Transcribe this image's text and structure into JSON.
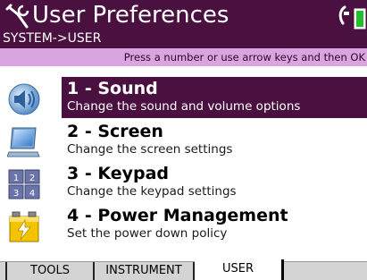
{
  "header": {
    "title": "User Preferences",
    "path": "SYSTEM->USER"
  },
  "hint": "Press a number or use arrow keys and then OK",
  "menu": {
    "items": [
      {
        "title": "1 - Sound",
        "description": "Change the sound and volume options",
        "icon": "speaker-icon",
        "selected": true
      },
      {
        "title": "2 - Screen",
        "description": "Change the screen settings",
        "icon": "monitor-icon",
        "selected": false
      },
      {
        "title": "3 - Keypad",
        "description": "Change the keypad settings",
        "icon": "keypad-icon",
        "selected": false
      },
      {
        "title": "4 - Power Management",
        "description": "Set the power down policy",
        "icon": "battery-charge-icon",
        "selected": false
      }
    ]
  },
  "tabs": [
    {
      "label": "TOOLS",
      "active": false
    },
    {
      "label": "INSTRUMENT",
      "active": false
    },
    {
      "label": "USER",
      "active": true
    }
  ],
  "colors": {
    "header_bg": "#4a1040",
    "hint_bg": "#d9a4df",
    "selected_bg": "#4a1040",
    "battery": "#22c02a"
  }
}
